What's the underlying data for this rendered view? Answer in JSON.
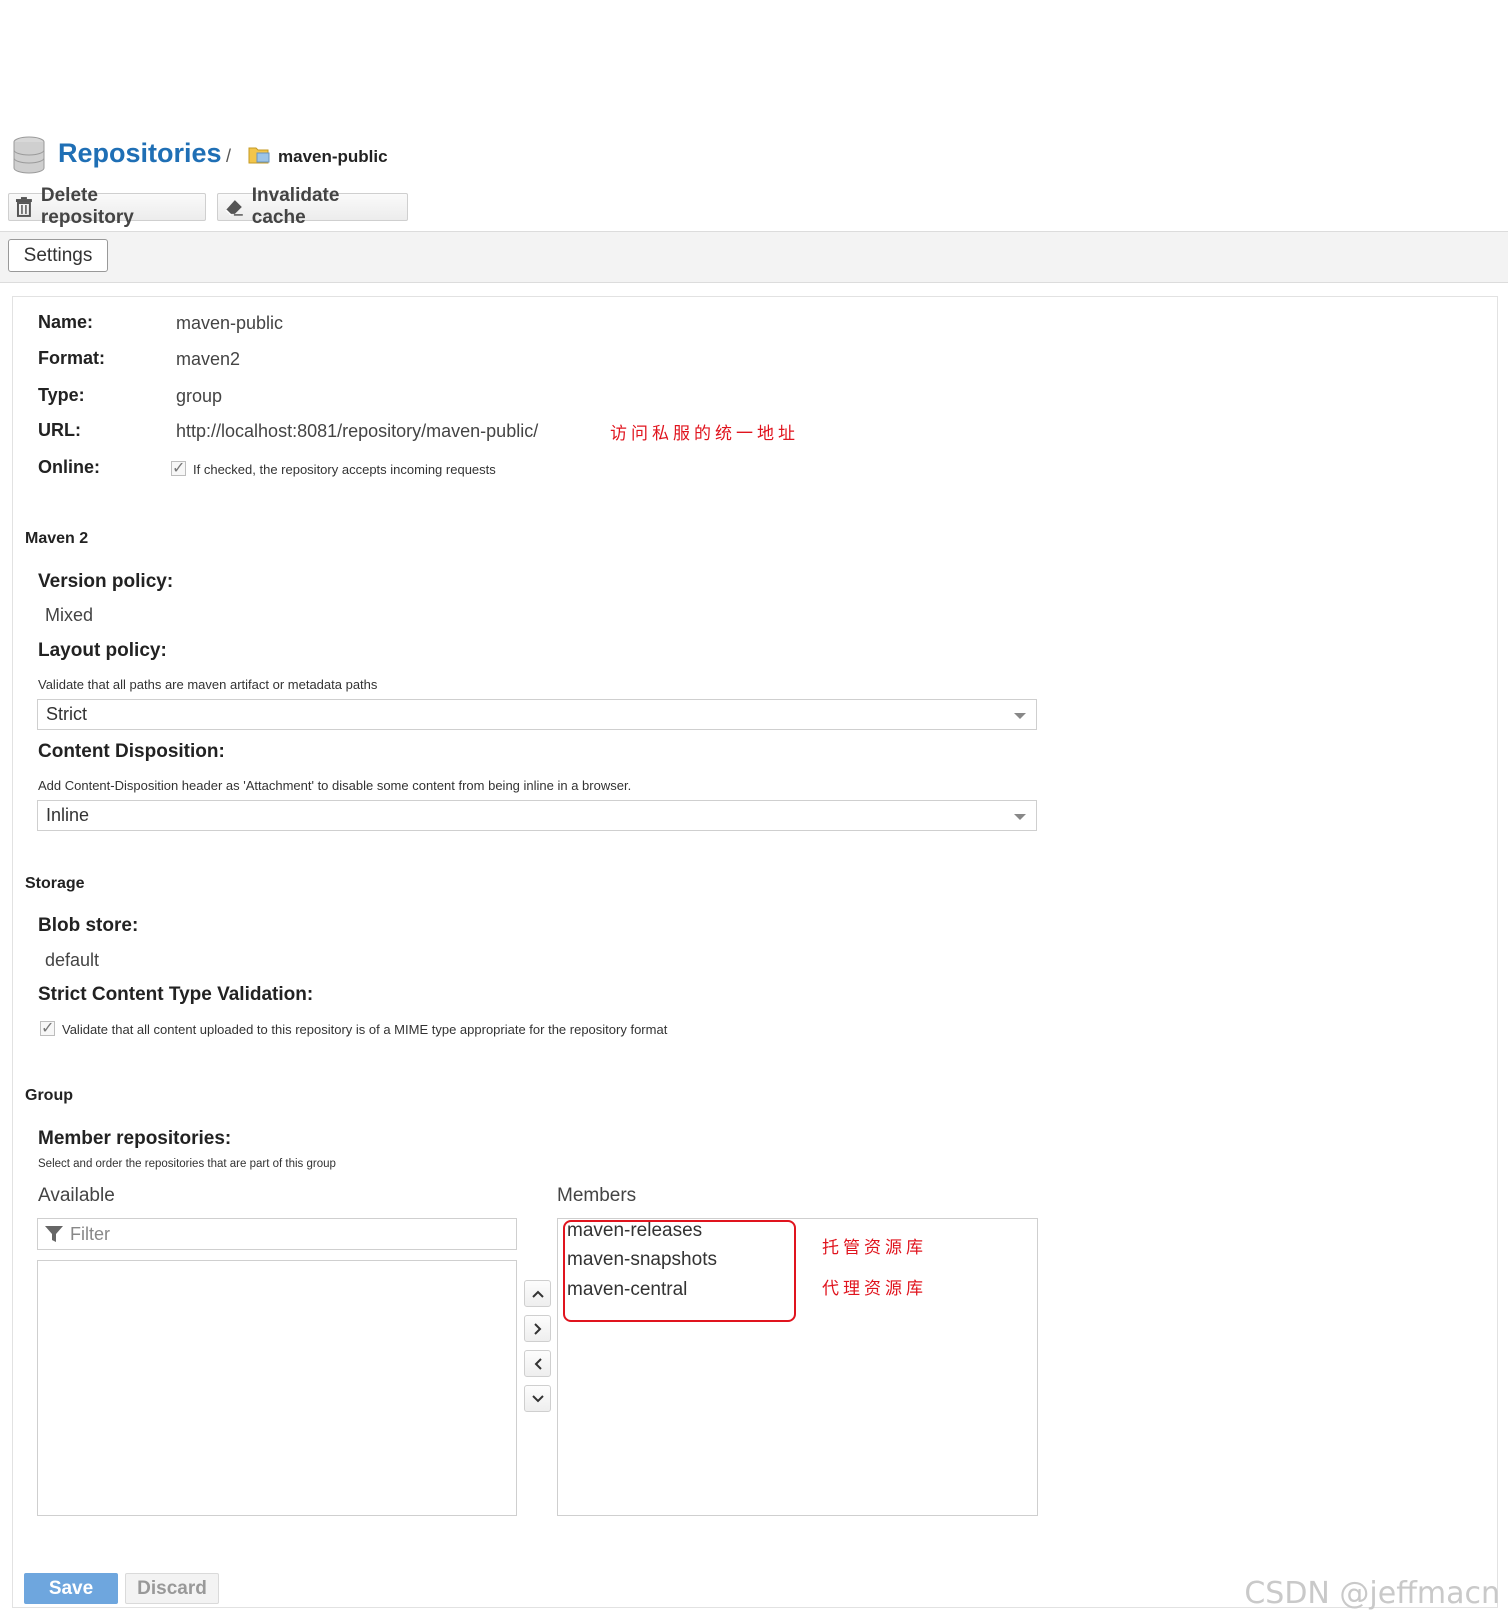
{
  "header": {
    "title": "Repositories",
    "separator": "/",
    "repo_name": "maven-public"
  },
  "toolbar": {
    "delete_label": "Delete repository",
    "invalidate_label": "Invalidate cache"
  },
  "tabs": {
    "settings": "Settings"
  },
  "info": {
    "name_label": "Name:",
    "name_value": "maven-public",
    "format_label": "Format:",
    "format_value": "maven2",
    "type_label": "Type:",
    "type_value": "group",
    "url_label": "URL:",
    "url_value": "http://localhost:8081/repository/maven-public/",
    "url_annotation": "访问私服的统一地址",
    "online_label": "Online:",
    "online_help": "If checked, the repository accepts incoming requests",
    "online_checked": true
  },
  "maven2": {
    "section": "Maven 2",
    "version_policy_label": "Version policy:",
    "version_policy_value": "Mixed",
    "layout_policy_label": "Layout policy:",
    "layout_policy_help": "Validate that all paths are maven artifact or metadata paths",
    "layout_policy_value": "Strict",
    "content_disposition_label": "Content Disposition:",
    "content_disposition_help": "Add Content-Disposition header as 'Attachment' to disable some content from being inline in a browser.",
    "content_disposition_value": "Inline"
  },
  "storage": {
    "section": "Storage",
    "blob_store_label": "Blob store:",
    "blob_store_value": "default",
    "strict_label": "Strict Content Type Validation:",
    "strict_help": "Validate that all content uploaded to this repository is of a MIME type appropriate for the repository format",
    "strict_checked": true
  },
  "group": {
    "section": "Group",
    "members_label": "Member repositories:",
    "members_help": "Select and order the repositories that are part of this group",
    "available_label": "Available",
    "members_title": "Members",
    "filter_placeholder": "Filter",
    "members": [
      "maven-releases",
      "maven-snapshots",
      "maven-central"
    ],
    "annotation_hosted": "托管资源库",
    "annotation_proxy": "代理资源库"
  },
  "footer": {
    "save_label": "Save",
    "discard_label": "Discard",
    "watermark": "CSDN @jeffmacn"
  },
  "colors": {
    "accent": "#1f6fb5",
    "annotation": "#e0141e",
    "save": "#6ea6de"
  }
}
